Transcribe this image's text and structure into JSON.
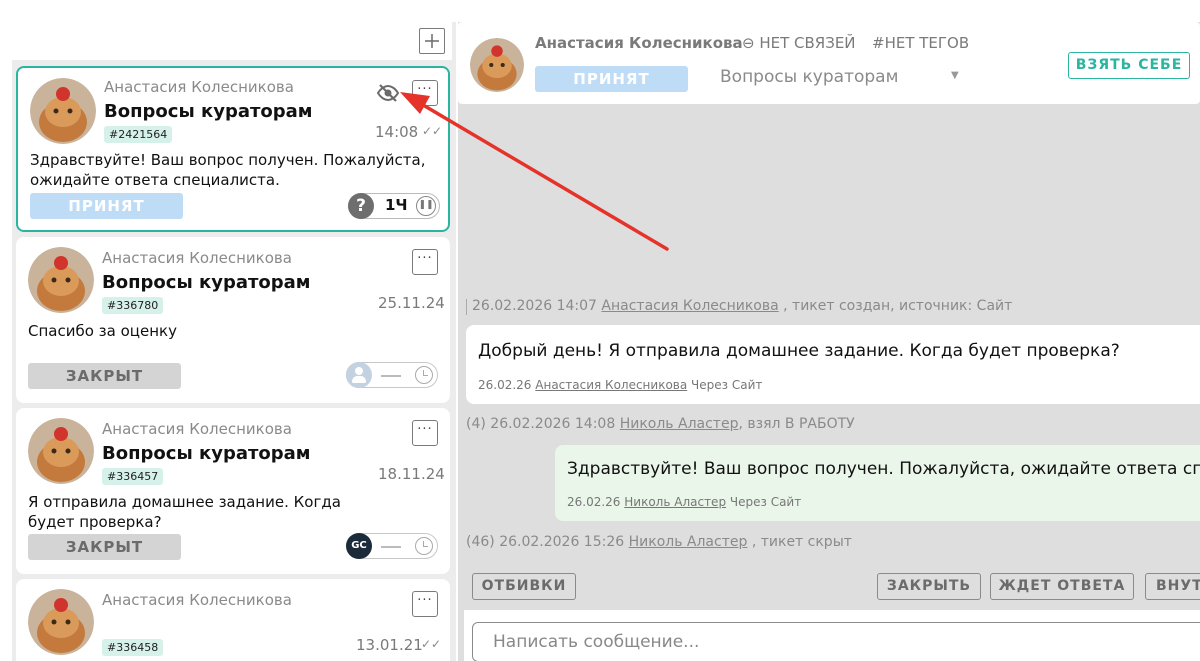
{
  "colors": {
    "accent": "#2bb5a0",
    "status_accepted": "#bfdcf7",
    "status_closed": "#d4d4d4",
    "annotation_arrow": "#e5332a"
  },
  "list": {
    "new_ticket_icon": "plus-icon",
    "tickets": [
      {
        "author": "Анастасия Колесникова",
        "subject": "Вопросы кураторам",
        "id": "#2421564",
        "time": "14:08",
        "message": "Здравствуйте! Ваш вопрос получен. Пожалуйста, ожидайте ответа специалиста.",
        "status": "ПРИНЯТ",
        "timer_label": "?",
        "timer_value": "1Ч",
        "hidden_icon": "eye-off-icon"
      },
      {
        "author": "Анастасия Колесникова",
        "subject": "Вопросы кураторам",
        "id": "#336780",
        "time": "25.11.24",
        "message": "Спасибо за оценку",
        "status": "ЗАКРЫТ"
      },
      {
        "author": "Анастасия Колесникова",
        "subject": "Вопросы кураторам",
        "id": "#336457",
        "time": "18.11.24",
        "message": "Я отправила домашнее задание. Когда будет проверка?",
        "status": "ЗАКРЫТ",
        "assignee_badge": "GC"
      },
      {
        "author": "Анастасия Колесникова",
        "subject": "",
        "id": "#336458",
        "time": "13.01.21",
        "message": "",
        "status": ""
      }
    ]
  },
  "chat": {
    "header": {
      "name": "Анастасия Колесникова",
      "links": "НЕТ СВЯЗЕЙ",
      "tags": "#НЕТ ТЕГОВ",
      "status": "ПРИНЯТ",
      "queue": "Вопросы кураторам",
      "take_button": "ВЗЯТЬ СЕБЕ"
    },
    "events": [
      {
        "prefix": "26.02.2026 14:07",
        "user": "Анастасия Колесникова",
        "suffix": ", тикет создан, источник: Сайт"
      },
      {
        "prefix": "(4) 26.02.2026 14:08",
        "user": "Николь Аластер",
        "suffix": ", взял В РАБОТУ"
      },
      {
        "prefix": "(46) 26.02.2026 15:26",
        "user": "Николь Аластер",
        "suffix": ", тикет скрыт"
      }
    ],
    "messages": [
      {
        "text": "Добрый день! Я отправила домашнее задание. Когда будет проверка?",
        "date": "26.02.26",
        "user": "Анастасия Колесникова",
        "via": "Через Сайт"
      },
      {
        "text": "Здравствуйте! Ваш вопрос получен. Пожалуйста, ожидайте ответа спе",
        "date": "26.02.26",
        "user": "Николь Аластер",
        "via": "Через Сайт"
      }
    ],
    "actions": {
      "canned": "ОТБИВКИ",
      "close": "ЗАКРЫТЬ",
      "waiting": "ЖДЕТ ОТВЕТА",
      "internal": "ВНУТ"
    },
    "composer_placeholder": "Написать сообщение..."
  }
}
